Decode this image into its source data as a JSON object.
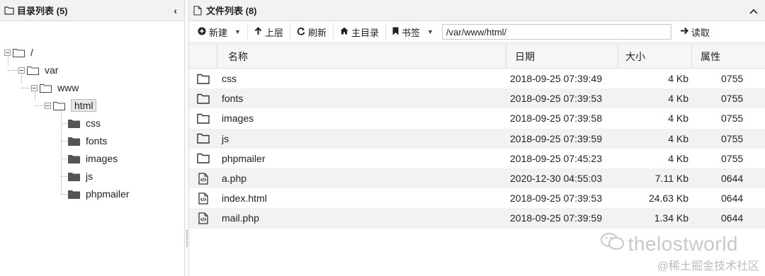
{
  "left_panel": {
    "title": "目录列表 (5)",
    "collapse_icon": "chevron-left-icon",
    "tree": [
      {
        "label": "/",
        "type": "folder-open"
      },
      {
        "label": "var",
        "type": "folder-open"
      },
      {
        "label": "www",
        "type": "folder-open"
      },
      {
        "label": "html",
        "type": "folder-open",
        "selected": true
      },
      {
        "label": "css",
        "type": "folder-closed"
      },
      {
        "label": "fonts",
        "type": "folder-closed"
      },
      {
        "label": "images",
        "type": "folder-closed"
      },
      {
        "label": "js",
        "type": "folder-closed"
      },
      {
        "label": "phpmailer",
        "type": "folder-closed"
      }
    ]
  },
  "right_panel": {
    "title": "文件列表 (8)",
    "collapse_icon": "chevron-up-icon"
  },
  "toolbar": {
    "new_label": "新建",
    "up_label": "上层",
    "refresh_label": "刷新",
    "home_label": "主目录",
    "bookmark_label": "书签",
    "path_value": "/var/www/html/",
    "read_label": "读取"
  },
  "table": {
    "columns": [
      "名称",
      "日期",
      "大小",
      "属性"
    ],
    "rows": [
      {
        "icon": "folder-icon",
        "name": "css",
        "date": "2018-09-25 07:39:49",
        "size": "4 Kb",
        "attr": "0755"
      },
      {
        "icon": "folder-icon",
        "name": "fonts",
        "date": "2018-09-25 07:39:53",
        "size": "4 Kb",
        "attr": "0755"
      },
      {
        "icon": "folder-icon",
        "name": "images",
        "date": "2018-09-25 07:39:58",
        "size": "4 Kb",
        "attr": "0755"
      },
      {
        "icon": "folder-icon",
        "name": "js",
        "date": "2018-09-25 07:39:59",
        "size": "4 Kb",
        "attr": "0755"
      },
      {
        "icon": "folder-icon",
        "name": "phpmailer",
        "date": "2018-09-25 07:45:23",
        "size": "4 Kb",
        "attr": "0755"
      },
      {
        "icon": "code-file-icon",
        "name": "a.php",
        "date": "2020-12-30 04:55:03",
        "size": "7.11 Kb",
        "attr": "0644"
      },
      {
        "icon": "code-file-icon",
        "name": "index.html",
        "date": "2018-09-25 07:39:53",
        "size": "24.63 Kb",
        "attr": "0644"
      },
      {
        "icon": "code-file-icon",
        "name": "mail.php",
        "date": "2018-09-25 07:39:59",
        "size": "1.34 Kb",
        "attr": "0644"
      }
    ]
  },
  "watermark": {
    "text": "thelostworld",
    "sub": "@稀土掘金技术社区"
  }
}
